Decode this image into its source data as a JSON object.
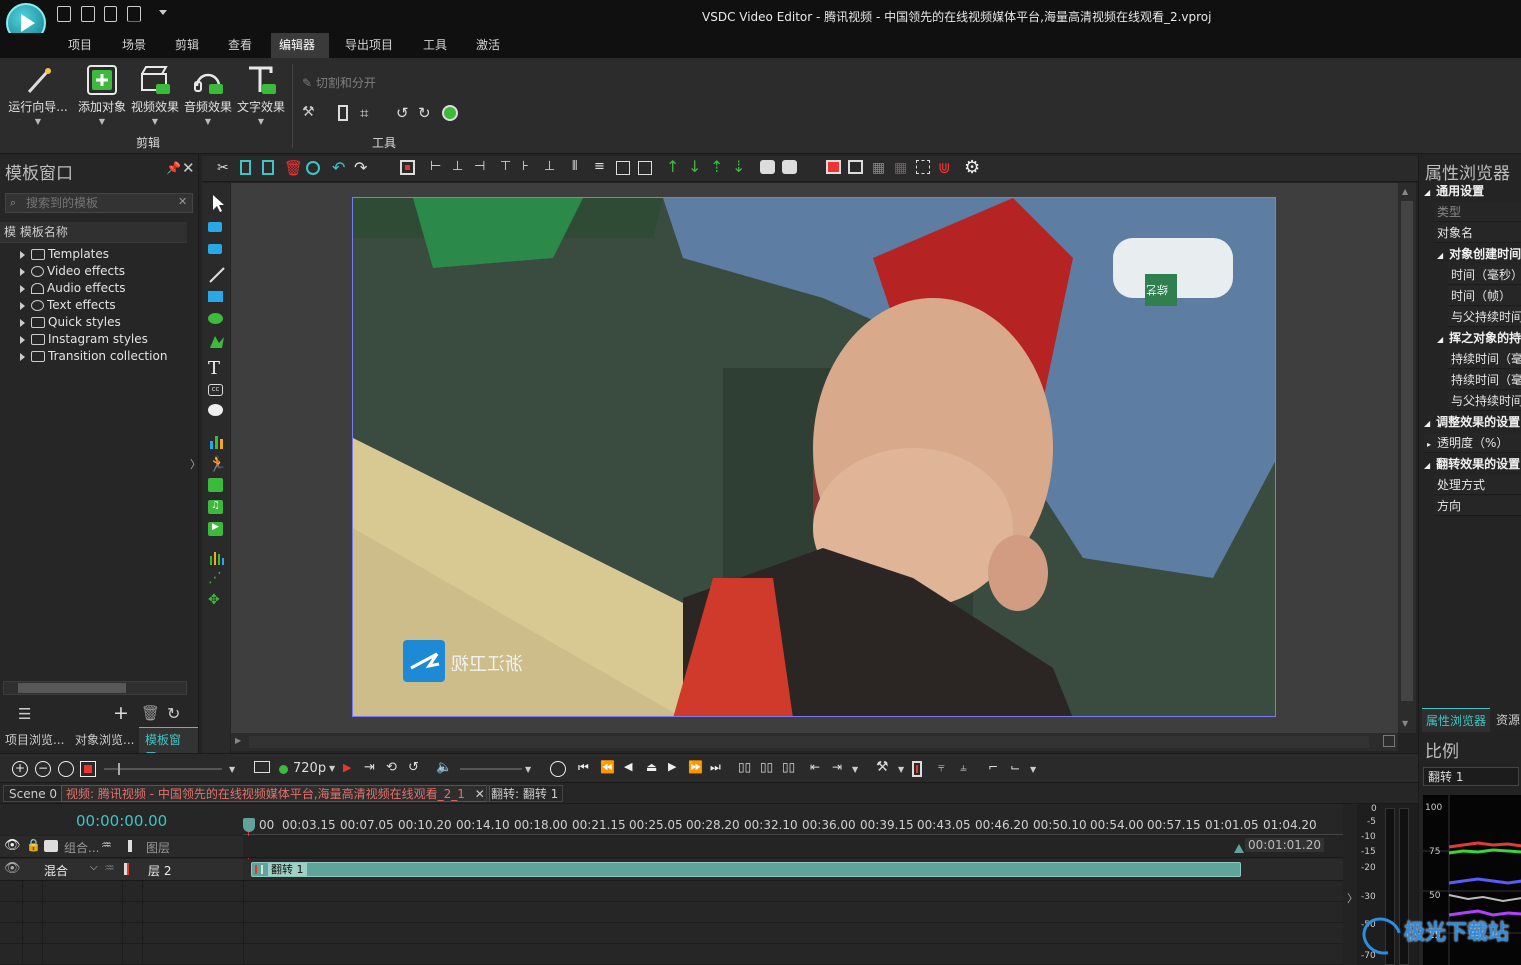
{
  "window": {
    "title": "VSDC Video Editor - 腾讯视频 - 中国领先的在线视频媒体平台,海量高清视频在线观看_2.vproj"
  },
  "menu": {
    "items": [
      "项目",
      "场景",
      "剪辑",
      "查看",
      "编辑器",
      "导出项目",
      "工具",
      "激活"
    ],
    "active": "编辑器"
  },
  "ribbon": {
    "buttons": [
      {
        "label": "运行向导...",
        "icon": "wand-icon"
      },
      {
        "label": "添加对象",
        "icon": "add-object-icon"
      },
      {
        "label": "视频效果",
        "icon": "video-fx-icon"
      },
      {
        "label": "音频效果",
        "icon": "audio-fx-icon"
      },
      {
        "label": "文字效果",
        "icon": "text-fx-icon"
      }
    ],
    "group_edit": "剪辑",
    "cut_split": "切割和分开",
    "group_tools": "工具"
  },
  "template_panel": {
    "title": "模板窗口",
    "search_placeholder": "搜索到的模板",
    "column_header": "模 模板名称",
    "items": [
      "Templates",
      "Video effects",
      "Audio effects",
      "Text effects",
      "Quick styles",
      "Instagram styles",
      "Transition collection"
    ]
  },
  "left_tabs": [
    "项目浏览...",
    "对象浏览...",
    "模板窗口"
  ],
  "preview": {
    "watermark_text": "浙江卫视",
    "logo_text": "综艺",
    "resolution": "720p"
  },
  "properties": {
    "title": "属性浏览器",
    "general": "通用设置",
    "type": "类型",
    "object_name": "对象名",
    "creation_time": "对象创建时间",
    "time_ms": "时间（毫秒）",
    "time_frames": "时间（帧）",
    "sync_parent": "与父持续时间",
    "duration_group": "挥之对象的持",
    "duration_ms": "持续时间（毫",
    "duration_frames": "持续时间（毫",
    "sync_parent2": "与父持续时间",
    "adjust": "调整效果的设置",
    "opacity": "透明度（%）",
    "flip": "翻转效果的设置",
    "process": "处理方式",
    "direction": "方向"
  },
  "right_tabs": [
    "属性浏览器",
    "资源"
  ],
  "scale_panel": {
    "title": "比例",
    "dropdown": "翻转 1",
    "levels": [
      "100",
      "75",
      "50",
      "25"
    ]
  },
  "timeline": {
    "scene": "Scene 0",
    "tab_video": "视频: 腾讯视频 - 中国领先的在线视频媒体平台,海量高清视频在线观看_2_1",
    "tab_flip": "翻转: 翻转 1",
    "timecode": "00:00:00.00",
    "ticks": [
      "00",
      "00:03.15",
      "00:07.05",
      "00:10.20",
      "00:14.10",
      "00:18.00",
      "00:21.15",
      "00:25.05",
      "00:28.20",
      "00:32.10",
      "00:36.00",
      "00:39.15",
      "00:43.05",
      "00:46.20",
      "00:50.10",
      "00:54.00",
      "00:57.15",
      "01:01.05",
      "01:04.20"
    ],
    "end_marker": "00:01:01.20",
    "track1_combo": "组合...",
    "track1_layer": "图层",
    "track2_blend": "混合",
    "track2_layer": "层 2",
    "clip_label": "翻转 1",
    "db_labels": [
      "0",
      "-5",
      "-10",
      "-15",
      "-20",
      "-30",
      "-50",
      "-70"
    ]
  },
  "site_watermark": "极光下载站",
  "colors": {
    "accent_green": "#3cba3c",
    "teal_clip": "#5fa39a",
    "highlight_cyan": "#3fc5c5"
  }
}
